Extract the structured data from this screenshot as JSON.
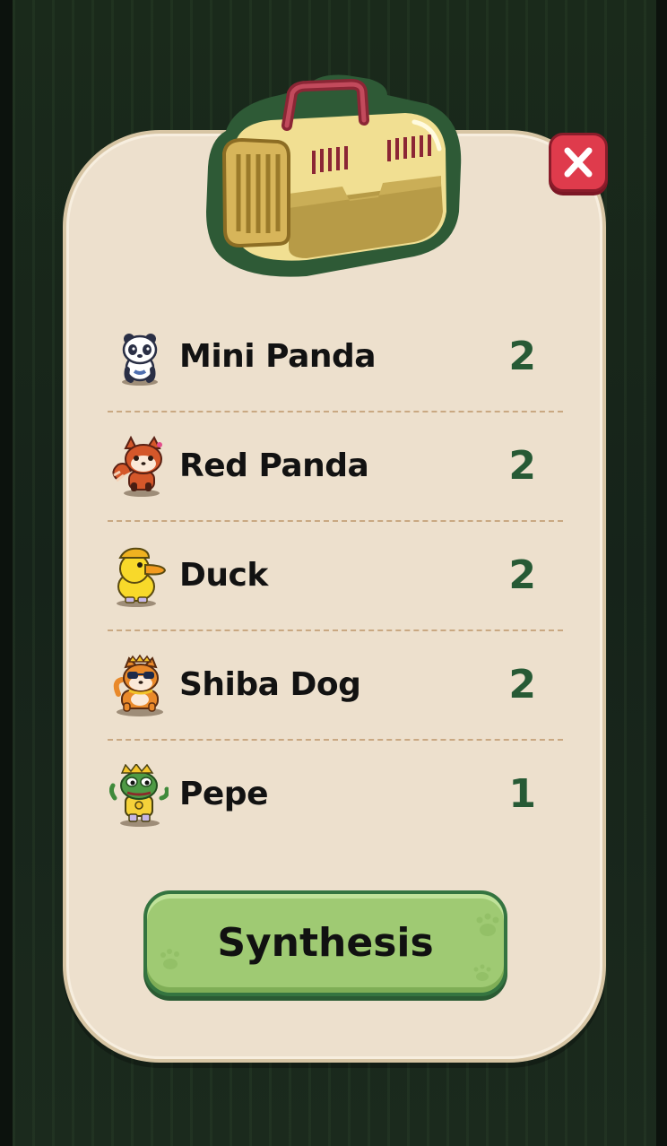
{
  "dialog": {
    "close_icon": "close-icon",
    "header_icon": "pet-carrier-icon"
  },
  "pets": [
    {
      "name": "Mini Panda",
      "count": "2",
      "icon": "mini-panda-icon"
    },
    {
      "name": "Red Panda",
      "count": "2",
      "icon": "red-panda-icon"
    },
    {
      "name": "Duck",
      "count": "2",
      "icon": "duck-icon"
    },
    {
      "name": "Shiba Dog",
      "count": "2",
      "icon": "shiba-dog-icon"
    },
    {
      "name": "Pepe",
      "count": "1",
      "icon": "pepe-icon"
    }
  ],
  "actions": {
    "synthesis_label": "Synthesis"
  },
  "colors": {
    "panel": "#ede0cd",
    "count_text": "#275a35",
    "button_green": "#9fca73",
    "close_red": "#df3b4c"
  }
}
